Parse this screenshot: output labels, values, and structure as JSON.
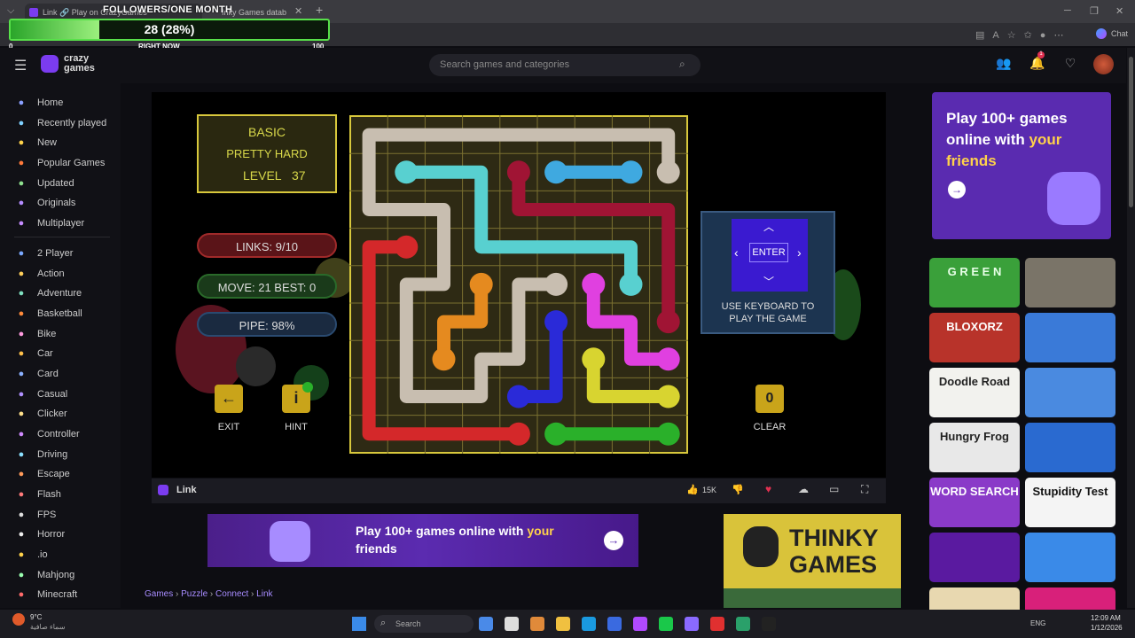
{
  "browser": {
    "tabs": [
      {
        "label": "Link 🔗 Play on CrazyGames"
      },
      {
        "label": "Inky Games datab"
      }
    ],
    "chat_label": "Chat"
  },
  "overlay": {
    "title": "FOLLOWERS/ONE MONTH",
    "progress_text": "28 (28%)",
    "progress": 0.28,
    "min": "0",
    "now_label": "RIGHT NOW",
    "max": "100"
  },
  "header": {
    "logo_line1": "crazy",
    "logo_line2": "games",
    "search_placeholder": "Search games and categories",
    "notification_count": "1"
  },
  "sidebar": {
    "items": [
      {
        "label": "Home",
        "icon": "home-icon",
        "color": "#8aa0ff"
      },
      {
        "label": "Recently played",
        "icon": "clock-icon",
        "color": "#7fd0ff"
      },
      {
        "label": "New",
        "icon": "sparkle-icon",
        "color": "#ffd24a"
      },
      {
        "label": "Popular Games",
        "icon": "fire-icon",
        "color": "#ff7a3a"
      },
      {
        "label": "Updated",
        "icon": "refresh-icon",
        "color": "#8ee08e"
      },
      {
        "label": "Originals",
        "icon": "originals-icon",
        "color": "#b48cff"
      },
      {
        "label": "Multiplayer",
        "icon": "multiplayer-icon",
        "color": "#c58cff"
      },
      {
        "label": "2 Player",
        "icon": "two-player-icon",
        "color": "#7aa8ff"
      },
      {
        "label": "Action",
        "icon": "sword-icon",
        "color": "#ffcf5a"
      },
      {
        "label": "Adventure",
        "icon": "compass-icon",
        "color": "#7fe0c0"
      },
      {
        "label": "Basketball",
        "icon": "basketball-icon",
        "color": "#ff8a3a"
      },
      {
        "label": "Bike",
        "icon": "bike-icon",
        "color": "#ff9adf"
      },
      {
        "label": "Car",
        "icon": "car-icon",
        "color": "#ffc04a"
      },
      {
        "label": "Card",
        "icon": "card-icon",
        "color": "#8ab0ff"
      },
      {
        "label": "Casual",
        "icon": "casual-icon",
        "color": "#b090ff"
      },
      {
        "label": "Clicker",
        "icon": "pointer-icon",
        "color": "#ffe08a"
      },
      {
        "label": "Controller",
        "icon": "gamepad-icon",
        "color": "#d08aff"
      },
      {
        "label": "Driving",
        "icon": "steering-icon",
        "color": "#8ae0ff"
      },
      {
        "label": "Escape",
        "icon": "door-icon",
        "color": "#ff9a5a"
      },
      {
        "label": "Flash",
        "icon": "flash-icon",
        "color": "#ff7a7a"
      },
      {
        "label": "FPS",
        "icon": "gun-icon",
        "color": "#dddddd"
      },
      {
        "label": "Horror",
        "icon": "ghost-icon",
        "color": "#eeeeee"
      },
      {
        "label": ".io",
        "icon": "io-icon",
        "color": "#ffd24a"
      },
      {
        "label": "Mahjong",
        "icon": "mahjong-icon",
        "color": "#9affb0"
      },
      {
        "label": "Minecraft",
        "icon": "block-icon",
        "color": "#ff6a6a"
      }
    ]
  },
  "game": {
    "level_box": {
      "mode": "BASIC",
      "difficulty": "PRETTY HARD",
      "level_label": "LEVEL",
      "level": "37"
    },
    "links": "LINKS:  9/10",
    "moves": "MOVE: 21   BEST: 0",
    "pipe": "PIPE:  98%",
    "exit_label": "EXIT",
    "hint_label": "HINT",
    "enter_label": "ENTER",
    "keyboard_hint_1": "USE KEYBOARD TO",
    "keyboard_hint_2": "PLAY THE GAME",
    "clear_count": "0",
    "clear_label": "CLEAR",
    "colors": {
      "red": "#d4282a",
      "cyan": "#58d0d0",
      "blue": "#3fa9e0",
      "orange": "#e58a1f",
      "grey": "#c8beb0",
      "magenta": "#e040e0",
      "navy": "#2a2ad8",
      "yellow": "#d8d430",
      "green": "#2ab02a",
      "crimson": "#a01434"
    }
  },
  "gamebar": {
    "title": "Link",
    "likes": "15K"
  },
  "banner": {
    "text_1": "Play 100+ games online with ",
    "text_highlight": "your",
    "text_2": "friends"
  },
  "ad": {
    "text_1": "THINKY",
    "text_2": "GAMES"
  },
  "breadcrumb": [
    "Games",
    "Puzzle",
    "Connect",
    "Link"
  ],
  "promo": {
    "line1": "Play 100+ games",
    "line2": "online with ",
    "highlight": "your",
    "line3": "friends"
  },
  "thumbs": [
    {
      "label": "G R E E N",
      "bg": "#3aa03a",
      "fg": "#e8ffe8"
    },
    {
      "label": "",
      "bg": "#7a7468",
      "fg": "#fff"
    },
    {
      "label": "BLOXORZ",
      "bg": "#b8332a",
      "fg": "#fff"
    },
    {
      "label": "",
      "bg": "#3a7ad8",
      "fg": "#fff"
    },
    {
      "label": "Doodle Road",
      "bg": "#f2f2ee",
      "fg": "#222"
    },
    {
      "label": "",
      "bg": "#4a8ae0",
      "fg": "#fff"
    },
    {
      "label": "Hungry Frog",
      "bg": "#e8e8e8",
      "fg": "#222"
    },
    {
      "label": "",
      "bg": "#2a6ad0",
      "fg": "#fff"
    },
    {
      "label": "WORD SEARCH",
      "bg": "#8a3ac8",
      "fg": "#fff"
    },
    {
      "label": "Stupidity Test",
      "bg": "#f4f4f4",
      "fg": "#111"
    },
    {
      "label": "",
      "bg": "#5a1aa0",
      "fg": "#fff"
    },
    {
      "label": "",
      "bg": "#3a8ae8",
      "fg": "#fff"
    },
    {
      "label": "",
      "bg": "#e8d8b0",
      "fg": "#fff"
    },
    {
      "label": "",
      "bg": "#d8207a",
      "fg": "#fff"
    }
  ],
  "taskbar": {
    "weather_temp": "9°C",
    "weather_text": "سماء صافية",
    "search_label": "Search",
    "lang": "ENG",
    "time": "12:09 AM",
    "date": "1/12/2026"
  }
}
